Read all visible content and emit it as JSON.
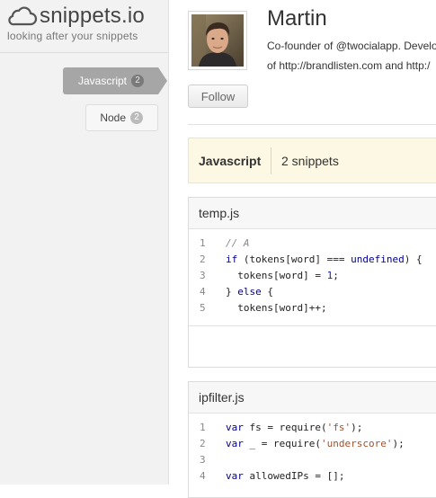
{
  "logo": {
    "name": "snippets.io",
    "tagline": "looking after your snippets",
    "icon": "cloud-icon"
  },
  "sidebar": {
    "items": [
      {
        "label": "Javascript",
        "count": "2",
        "active": true
      },
      {
        "label": "Node",
        "count": "2",
        "active": false
      }
    ]
  },
  "profile": {
    "name": "Martin",
    "bio_line1": "Co-founder of @twocialapp. Develop",
    "bio_line2": "of http://brandlisten.com and http:/",
    "follow_label": "Follow"
  },
  "filter": {
    "language": "Javascript",
    "count_label": "2 snippets"
  },
  "snippets": [
    {
      "filename": "temp.js",
      "lines": [
        {
          "n": "1",
          "t": "// A"
        },
        {
          "n": "2",
          "t": "if (tokens[word] === undefined) {"
        },
        {
          "n": "3",
          "t": "  tokens[word] = 1;"
        },
        {
          "n": "4",
          "t": "} else {"
        },
        {
          "n": "5",
          "t": "  tokens[word]++;"
        }
      ]
    },
    {
      "filename": "ipfilter.js",
      "lines": [
        {
          "n": "1",
          "t": "var fs = require('fs');"
        },
        {
          "n": "2",
          "t": "var _ = require('underscore');"
        },
        {
          "n": "3",
          "t": ""
        },
        {
          "n": "4",
          "t": "var allowedIPs = [];"
        }
      ]
    }
  ],
  "colors": {
    "sidebar_bg": "#f2f2f2",
    "active_nav": "#a6a6a6",
    "filter_bg": "#fcf8e3",
    "keyword": "#00008b",
    "string": "#a0522d",
    "comment": "#8a8a8a"
  }
}
